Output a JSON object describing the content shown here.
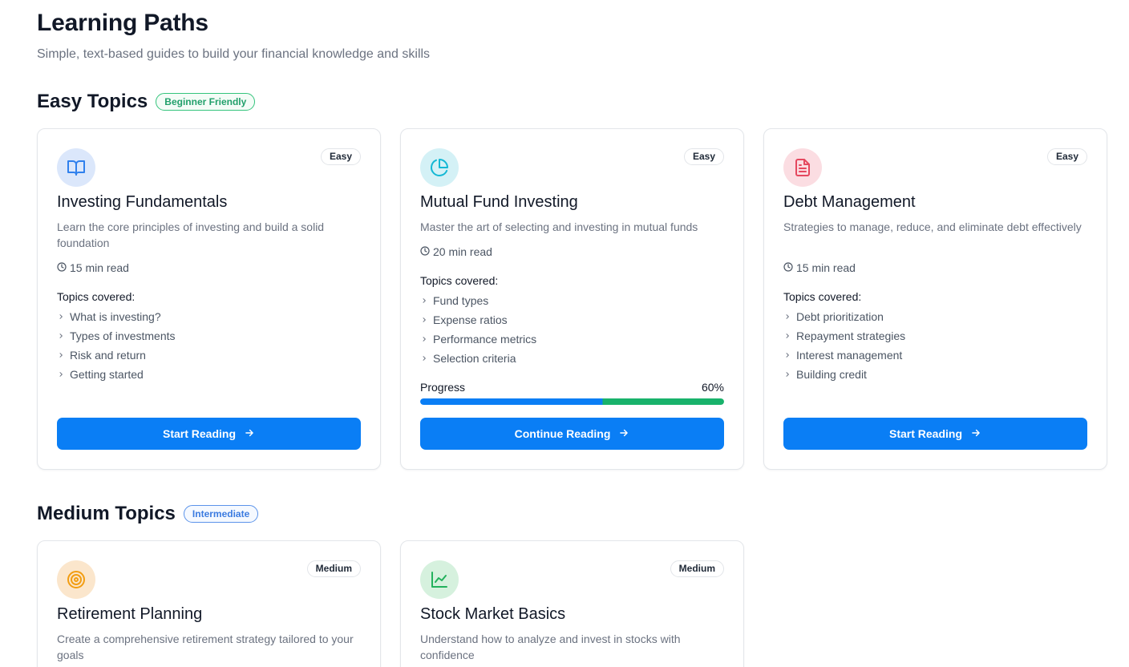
{
  "header": {
    "title": "Learning Paths",
    "subtitle": "Simple, text-based guides to build your financial knowledge and skills"
  },
  "sections": [
    {
      "title": "Easy Topics",
      "badge": "Beginner Friendly",
      "badge_color": "#22a06b",
      "cards": [
        {
          "title": "Investing Fundamentals",
          "difficulty": "Easy",
          "description": "Learn the core principles of investing and build a solid foundation",
          "read_time": "15 min read",
          "topics_label": "Topics covered:",
          "topics": [
            "What is investing?",
            "Types of investments",
            "Risk and return",
            "Getting started"
          ],
          "button": "Start Reading",
          "icon": "book-icon",
          "icon_color": "#2f80ed",
          "icon_bg": "#dbe7fb"
        },
        {
          "title": "Mutual Fund Investing",
          "difficulty": "Easy",
          "description": "Master the art of selecting and investing in mutual funds",
          "read_time": "20 min read",
          "topics_label": "Topics covered:",
          "topics": [
            "Fund types",
            "Expense ratios",
            "Performance metrics",
            "Selection criteria"
          ],
          "progress_label": "Progress",
          "progress_text": "60%",
          "progress": 0.6,
          "button": "Continue Reading",
          "icon": "pie-chart-icon",
          "icon_color": "#14b8d4",
          "icon_bg": "#d4f1f6"
        },
        {
          "title": "Debt Management",
          "difficulty": "Easy",
          "description": "Strategies to manage, reduce, and eliminate debt effectively",
          "read_time": "15 min read",
          "topics_label": "Topics covered:",
          "topics": [
            "Debt prioritization",
            "Repayment strategies",
            "Interest management",
            "Building credit"
          ],
          "button": "Start Reading",
          "icon": "document-icon",
          "icon_color": "#e5485f",
          "icon_bg": "#fbdde2"
        }
      ]
    },
    {
      "title": "Medium Topics",
      "badge": "Intermediate",
      "badge_color": "#3b7be0",
      "cards": [
        {
          "title": "Retirement Planning",
          "difficulty": "Medium",
          "description": "Create a comprehensive retirement strategy tailored to your goals",
          "icon": "target-icon",
          "icon_color": "#f29d12",
          "icon_bg": "#fbe6cc"
        },
        {
          "title": "Stock Market Basics",
          "difficulty": "Medium",
          "description": "Understand how to analyze and invest in stocks with confidence",
          "icon": "trend-chart-icon",
          "icon_color": "#22b15c",
          "icon_bg": "#d6f1de"
        }
      ]
    }
  ],
  "colors": {
    "primary": "#0a7ef5",
    "progress_secondary": "#18b26b",
    "text": "#111827",
    "muted": "#6b7280"
  }
}
